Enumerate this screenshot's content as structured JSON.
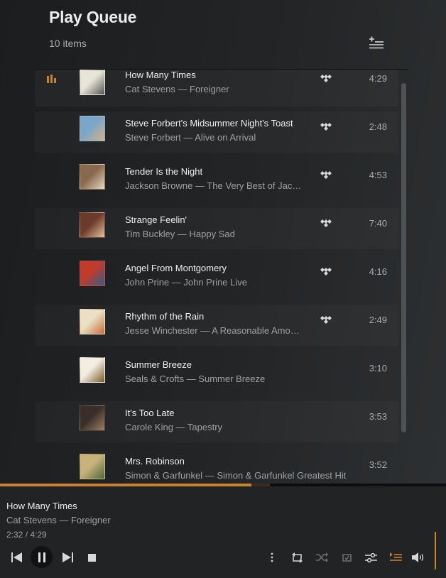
{
  "header": {
    "title": "Play Queue",
    "count": "10 items"
  },
  "queue": [
    {
      "title": "How Many Times",
      "subtitle": "Cat Stevens — Foreigner",
      "duration": "4:29",
      "tidal": true,
      "current": true
    },
    {
      "title": "Steve Forbert's Midsummer Night's Toast",
      "subtitle": "Steve Forbert — Alive on Arrival",
      "duration": "2:48",
      "tidal": true,
      "current": false
    },
    {
      "title": "Tender Is the Night",
      "subtitle": "Jackson Browne — The Very Best of Jacks...",
      "duration": "4:53",
      "tidal": true,
      "current": false
    },
    {
      "title": "Strange Feelin'",
      "subtitle": "Tim Buckley — Happy Sad",
      "duration": "7:40",
      "tidal": true,
      "current": false
    },
    {
      "title": "Angel From Montgomery",
      "subtitle": "John Prine — John Prine Live",
      "duration": "4:16",
      "tidal": true,
      "current": false
    },
    {
      "title": "Rhythm of the Rain",
      "subtitle": "Jesse Winchester — A Reasonable Amoun...",
      "duration": "2:49",
      "tidal": true,
      "current": false
    },
    {
      "title": "Summer Breeze",
      "subtitle": "Seals & Crofts — Summer Breeze",
      "duration": "3:10",
      "tidal": false,
      "current": false
    },
    {
      "title": "It's Too Late",
      "subtitle": "Carole King — Tapestry",
      "duration": "3:53",
      "tidal": false,
      "current": false
    },
    {
      "title": "Mrs. Robinson",
      "subtitle": "Simon & Garfunkel — Simon & Garfunkel Greatest Hit",
      "duration": "3:52",
      "tidal": false,
      "current": false
    }
  ],
  "now_playing": {
    "title": "How Many Times",
    "subtitle": "Cat Stevens — Foreigner",
    "time": "2:32 / 4:29",
    "progress_fraction": 0.565
  },
  "icons": {
    "playing": "playing-bars-icon",
    "tidal": "tidal-icon",
    "add_to_playlist": "add-to-playlist-icon",
    "controls": [
      "previous-icon",
      "pause-icon",
      "next-icon",
      "stop-icon",
      "more-icon",
      "repeat-icon",
      "shuffle-icon",
      "consume-icon",
      "equalizer-icon",
      "queue-icon",
      "volume-icon"
    ]
  },
  "colors": {
    "accent": "#c7832e",
    "background": "#1f2022",
    "text": "#ececec",
    "muted": "#9fa2a4"
  }
}
